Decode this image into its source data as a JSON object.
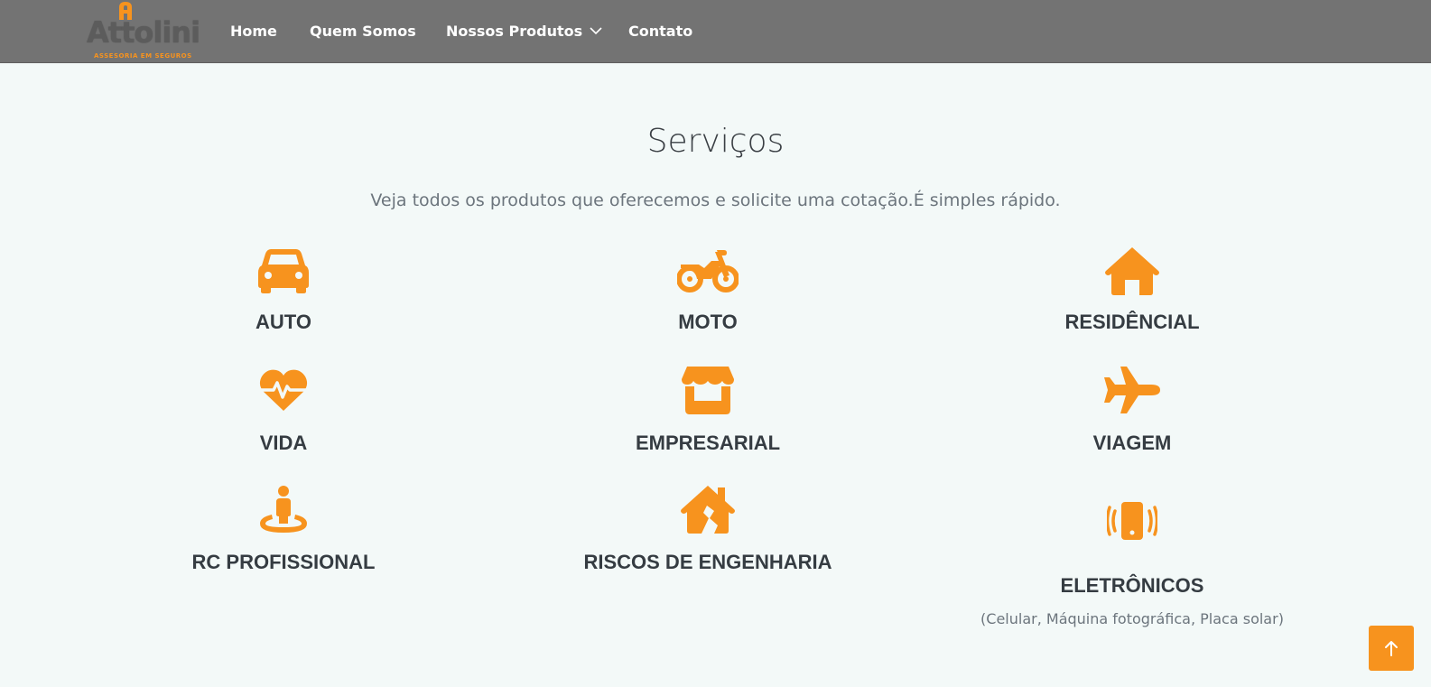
{
  "header": {
    "logo": {
      "text": "Attolini",
      "tagline": "ASSESORIA EM SEGUROS"
    },
    "nav": [
      {
        "label": "Home"
      },
      {
        "label": "Quem Somos"
      },
      {
        "label": "Nossos Produtos",
        "dropdown": true
      },
      {
        "label": "Contato"
      }
    ]
  },
  "services": {
    "title": "Serviços",
    "subtitle": "Veja todos os produtos que oferecemos e solicite uma cotação.É simples rápido.",
    "items": [
      {
        "icon": "car-icon",
        "label": "AUTO"
      },
      {
        "icon": "motorcycle-icon",
        "label": "MOTO"
      },
      {
        "icon": "house-icon",
        "label": "RESIDÊNCIAL"
      },
      {
        "icon": "heart-pulse-icon",
        "label": "VIDA"
      },
      {
        "icon": "shop-icon",
        "label": "EMPRESARIAL"
      },
      {
        "icon": "airplane-icon",
        "label": "VIAGEM"
      },
      {
        "icon": "person-pin-icon",
        "label": "RC PROFISSIONAL"
      },
      {
        "icon": "house-crack-icon",
        "label": "RISCOS DE ENGENHARIA"
      },
      {
        "icon": "vibrating-phone-icon",
        "label": "ELETRÔNICOS",
        "note": "(Celular, Máquina fotográfica, Placa solar)"
      }
    ]
  },
  "scroll_top": {
    "icon": "arrow-up-icon"
  },
  "colors": {
    "accent": "#f7931e",
    "header_bg": "#737373",
    "page_bg": "#f3f9f8",
    "heading": "#353c42"
  }
}
